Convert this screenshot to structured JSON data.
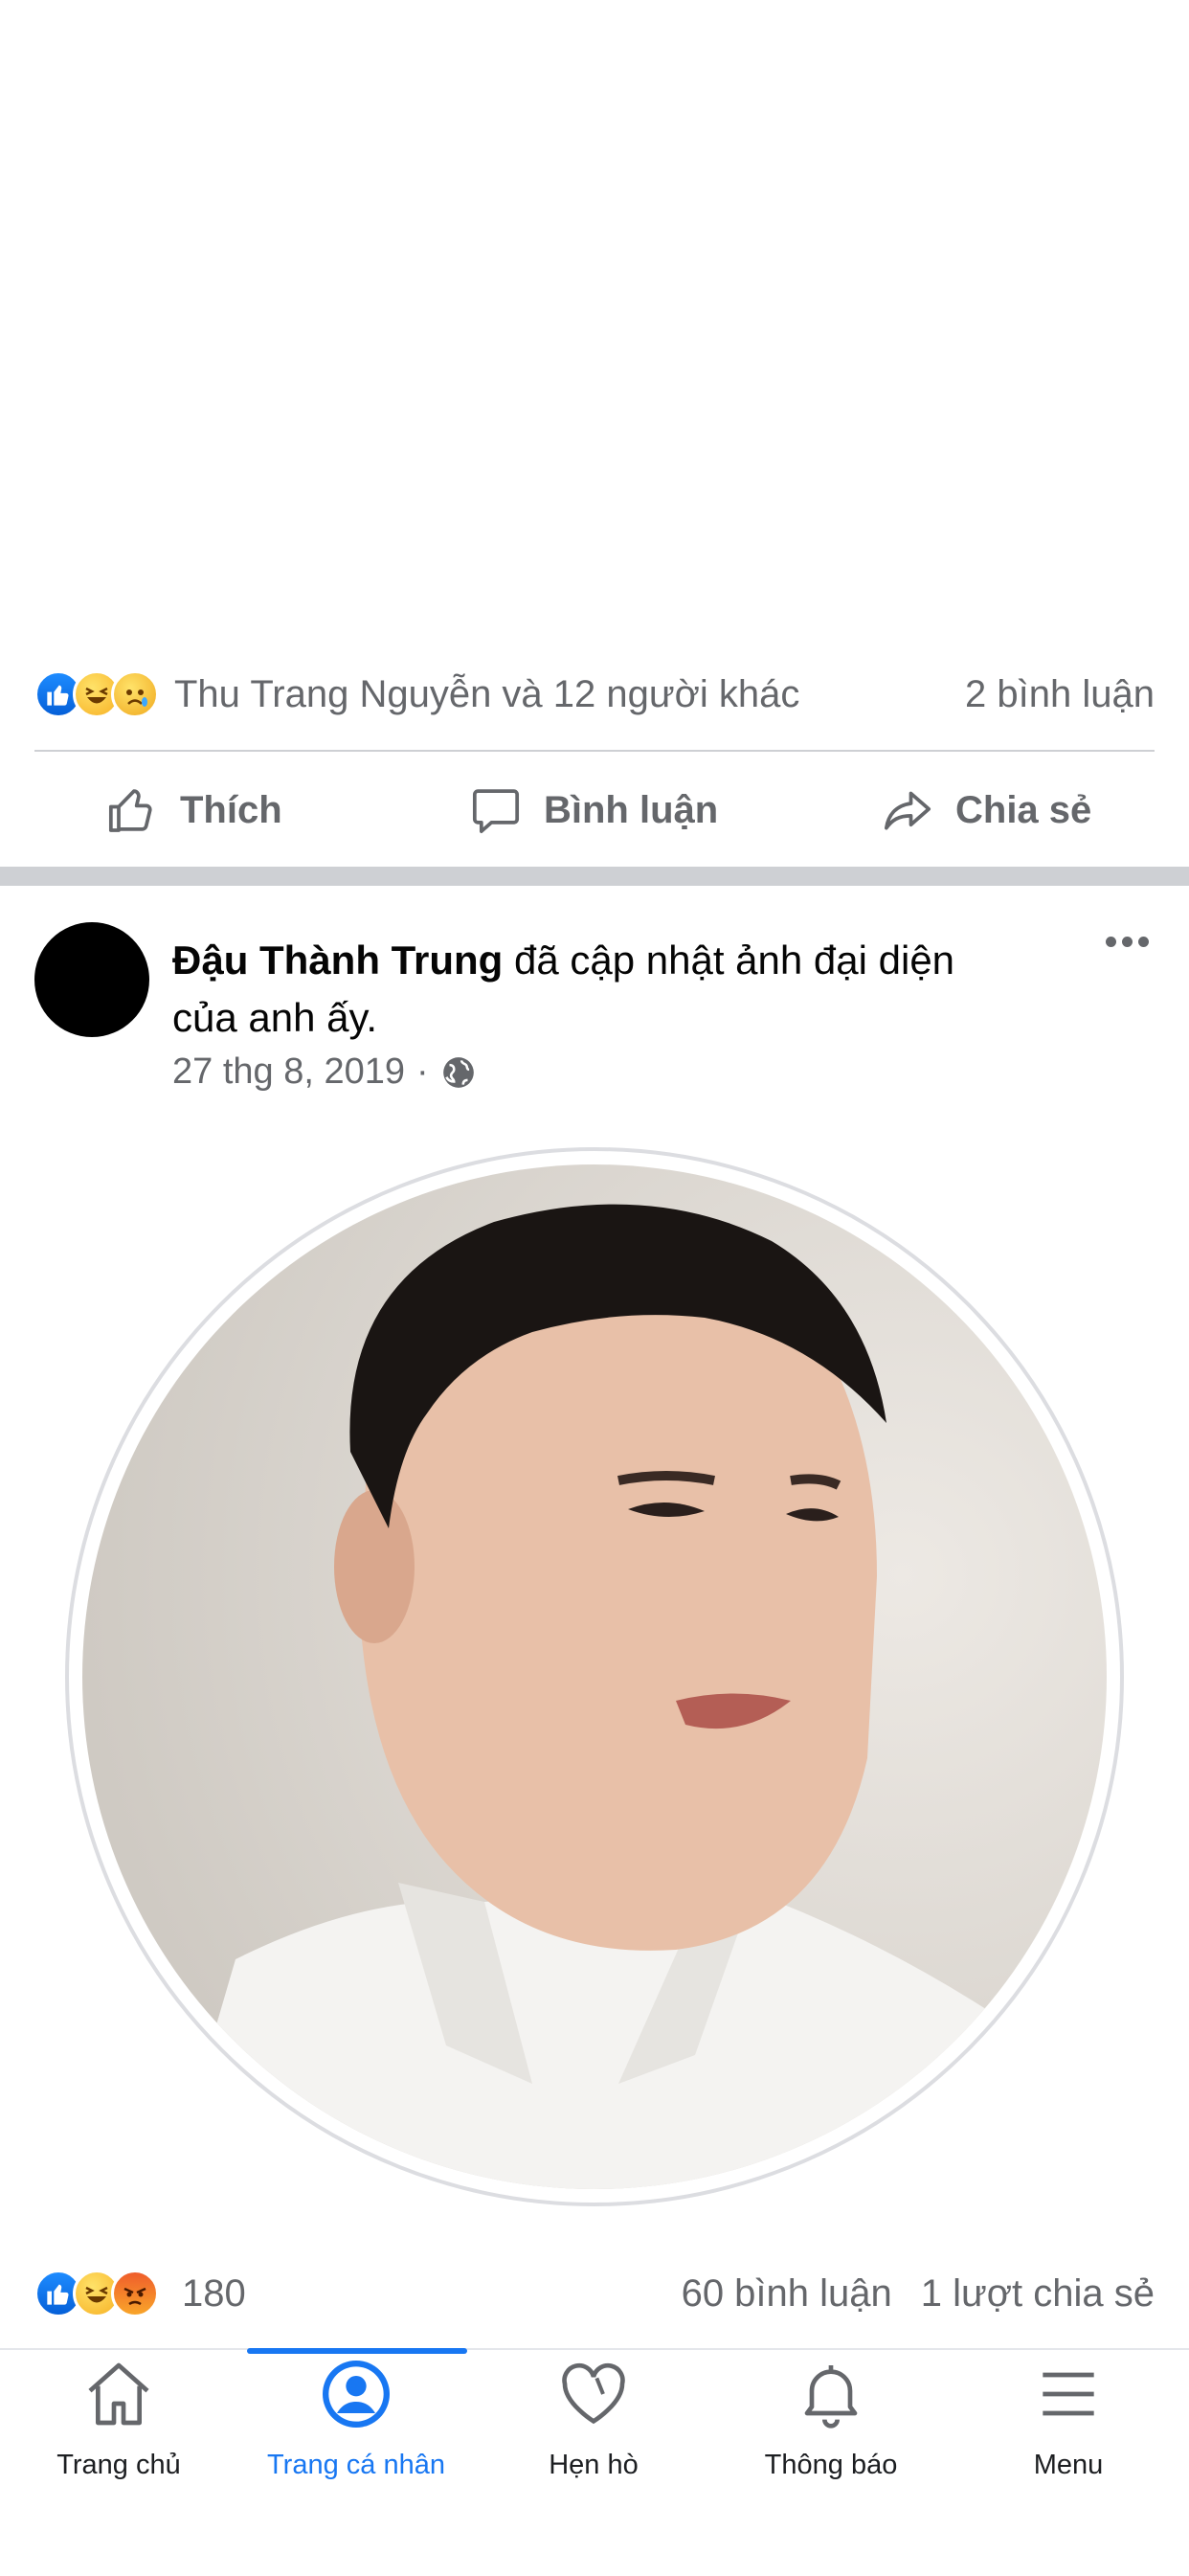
{
  "post1": {
    "reaction_summary": "Thu Trang Nguyễn và 12 người khác",
    "comments": "2 bình luận",
    "actions": {
      "like": "Thích",
      "comment": "Bình luận",
      "share": "Chia sẻ"
    }
  },
  "post2": {
    "author": "Đậu Thành Trung",
    "action_text": "đã cập nhật ảnh đại diện",
    "action_text_2": "của anh ấy.",
    "date": "27 thg 8, 2019",
    "separator": "·",
    "reaction_count": "180",
    "comments": "60 bình luận",
    "shares": "1 lượt chia sẻ"
  },
  "tabbar": {
    "tabs": [
      {
        "label": "Trang chủ",
        "icon": "home-icon"
      },
      {
        "label": "Trang cá nhân",
        "icon": "profile-icon",
        "active": true
      },
      {
        "label": "Hẹn hò",
        "icon": "heart-icon"
      },
      {
        "label": "Thông báo",
        "icon": "bell-icon"
      },
      {
        "label": "Menu",
        "icon": "menu-icon"
      }
    ]
  },
  "colors": {
    "accent": "#1877f2",
    "muted": "#65676b",
    "divider": "#ced0d4"
  }
}
